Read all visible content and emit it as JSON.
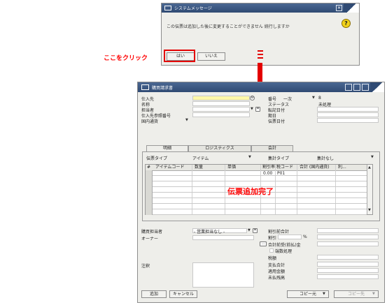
{
  "message": {
    "title": "システムメッセージ",
    "text": "この伝票は追加した後に変更することができません 続行しますか",
    "yes_label": "はい",
    "no_label": "いいえ"
  },
  "annotation": {
    "click_here": "ここをクリック",
    "completed": "伝票追加完了"
  },
  "window": {
    "title": "購買請求書",
    "header_left": [
      {
        "label": "仕入先"
      },
      {
        "label": "名称"
      },
      {
        "label": "担当者"
      },
      {
        "label": "仕入先参照番号"
      },
      {
        "label": "国内通貨"
      }
    ],
    "header_right": {
      "number_label": "番号",
      "series": "一次",
      "number_value": "8",
      "status_label": "ステータス",
      "status_value": "未処理",
      "posting_date_label": "転記日付",
      "due_date_label": "期日",
      "document_date_label": "伝票日付"
    },
    "tabs": [
      "明細",
      "ロジスティクス",
      "会計"
    ],
    "item_type_label": "伝票タイプ",
    "item_type_value": "アイテム",
    "summary_type_label": "集計タイプ",
    "summary_type_value": "集計なし",
    "grid_headers": [
      "#",
      "アイテムコード",
      "数量",
      "単価",
      "割引率",
      "税コード",
      "合計 (国内通貨)",
      "利..."
    ],
    "grid_first_row": {
      "discount": "0.00",
      "tax": "P01"
    },
    "buyer_label": "購買担当者",
    "buyer_value": "- 営業担当なし -",
    "owner_label": "オーナー",
    "remarks_label": "注釈",
    "totals": [
      "割引前合計",
      "割引",
      "合計前受(前払)金",
      "端数処理",
      "税額",
      "支払合計",
      "適用金額",
      "未払残高"
    ],
    "discount_unit": "%",
    "buttons": {
      "add": "追加",
      "cancel": "キャンセル",
      "copy_from": "コピー元",
      "copy_to": "コピー先"
    }
  }
}
